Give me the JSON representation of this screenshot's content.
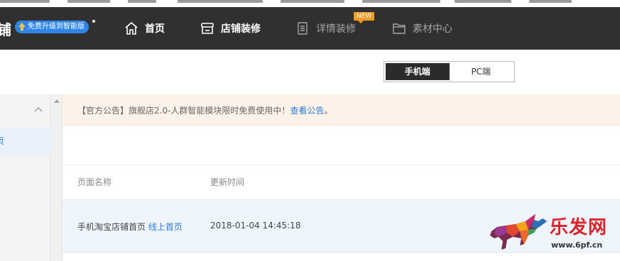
{
  "navbar": {
    "brand_char": "铺",
    "upgrade_label": "免费升级到智能版",
    "items": [
      {
        "label": "首页",
        "icon": "home-icon"
      },
      {
        "label": "店铺装修",
        "icon": "store-icon"
      },
      {
        "label": "详情装修",
        "icon": "document-icon",
        "badge": "NEW"
      },
      {
        "label": "素材中心",
        "icon": "folder-icon"
      }
    ]
  },
  "device_toggle": {
    "options": [
      "手机端",
      "PC端"
    ],
    "selected": "手机端"
  },
  "sidebar": {
    "item_label": "页"
  },
  "notice": {
    "prefix": "【官方公告】",
    "text": "旗舰店2.0-人群智能模块限时免费使用中！",
    "link": "查看公告",
    "suffix": "。"
  },
  "table": {
    "columns": [
      "页面名称",
      "更新时间"
    ],
    "rows": [
      {
        "name": "手机淘宝店铺首页",
        "tag": "线上首页",
        "updated": "2018-01-04 14:45:18"
      }
    ]
  },
  "watermark": {
    "logo_text": "乐发网",
    "url": "www.6pf.cn"
  },
  "colors": {
    "navbar_bg": "#303030",
    "accent_blue": "#2b7bd6",
    "badge_orange": "#f59a23",
    "notice_bg": "#fdf2ea",
    "row_highlight": "#eef5fc"
  }
}
